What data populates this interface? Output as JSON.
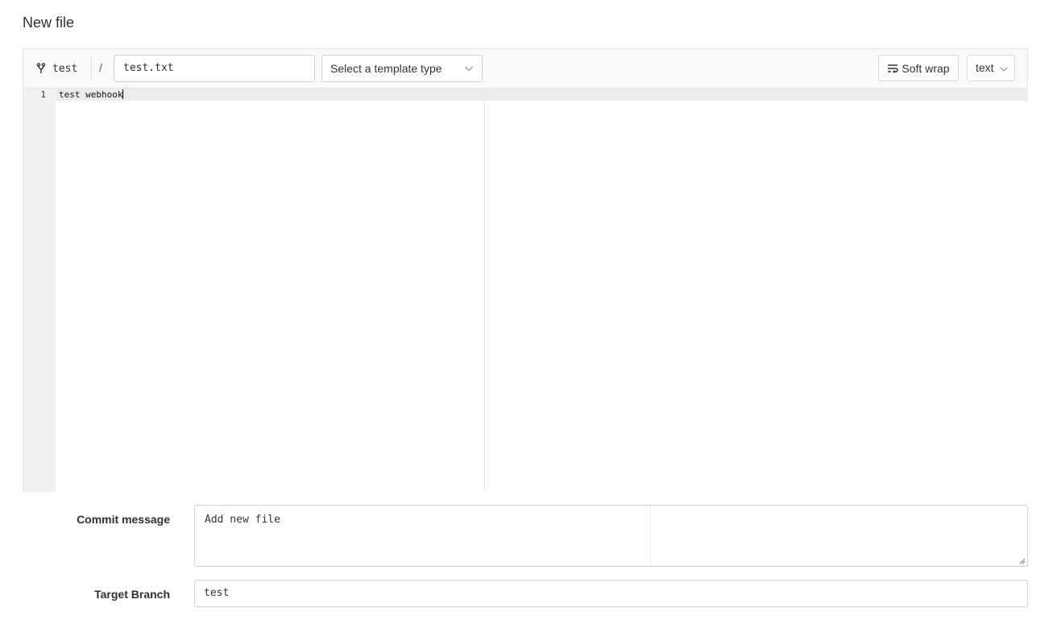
{
  "page": {
    "title": "New file"
  },
  "toolbar": {
    "branch_name": "test",
    "separator": "/",
    "file_name": "test.txt",
    "template_placeholder": "Select a template type",
    "soft_wrap_label": "Soft wrap",
    "mode_label": "text"
  },
  "editor": {
    "lines": [
      {
        "number": "1",
        "text": "test webhook"
      }
    ]
  },
  "form": {
    "commit_message_label": "Commit message",
    "commit_message_value": "Add new file",
    "target_branch_label": "Target Branch",
    "target_branch_value": "test"
  },
  "icons": {
    "branch": "fork-icon",
    "template_dropdown": "chevron-down-icon",
    "soft_wrap": "wrap-icon",
    "mode_dropdown": "chevron-down-icon"
  }
}
